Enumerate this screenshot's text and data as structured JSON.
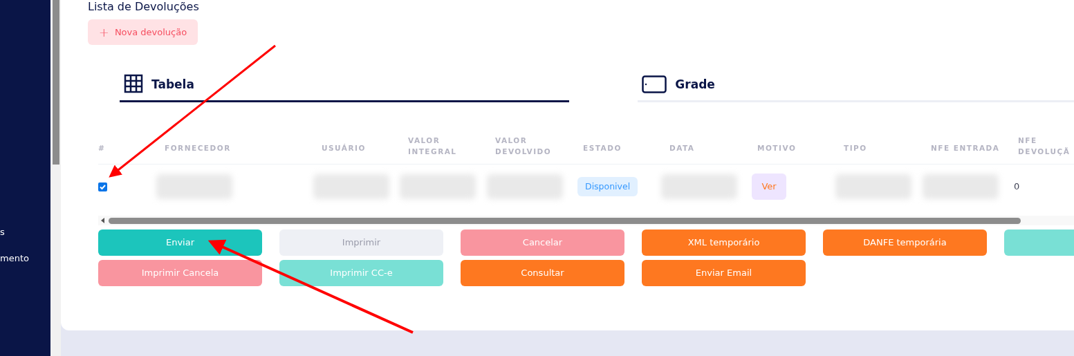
{
  "sidebar": {
    "items": [
      {
        "label": "s"
      },
      {
        "label": "mento"
      }
    ]
  },
  "page": {
    "title": "Lista de Devoluções",
    "new_button": {
      "icon": "+",
      "label": "Nova devolução"
    }
  },
  "tabs": [
    {
      "label": "Tabela",
      "selected": true
    },
    {
      "label": "Grade",
      "selected": false
    }
  ],
  "table": {
    "columns": [
      "#",
      "FORNECEDOR",
      "USUÁRIO",
      "VALOR INTEGRAL",
      "VALOR DEVOLVIDO",
      "ESTADO",
      "DATA",
      "MOTIVO",
      "TIPO",
      "NFE ENTRADA",
      "NFE DEVOLUÇÃ"
    ],
    "rows": [
      {
        "checked": true,
        "cells": [
          {
            "kind": "checkbox"
          },
          {
            "kind": "redacted"
          },
          {
            "kind": "redacted"
          },
          {
            "kind": "redacted"
          },
          {
            "kind": "redacted"
          },
          {
            "kind": "badge",
            "text": "Disponivel"
          },
          {
            "kind": "redacted"
          },
          {
            "kind": "link",
            "text": "Ver"
          },
          {
            "kind": "redacted"
          },
          {
            "kind": "redacted"
          },
          {
            "kind": "text",
            "text": "0"
          }
        ]
      }
    ]
  },
  "actions": [
    {
      "label": "Enviar",
      "color": "#1cc5bc",
      "kind": "solid"
    },
    {
      "label": "Imprimir",
      "color": "#eef0f5",
      "kind": "light"
    },
    {
      "label": "Cancelar",
      "color": "#f9959f",
      "kind": "solid"
    },
    {
      "label": "XML temporário",
      "color": "#fe7820",
      "kind": "solid"
    },
    {
      "label": "DANFE temporária",
      "color": "#fe7820",
      "kind": "solid"
    },
    {
      "color": "#79e0d5",
      "kind": "solid"
    },
    {
      "label": "Imprimir Cancela",
      "color": "#f9959f",
      "kind": "solid"
    },
    {
      "label": "Imprimir CC-e",
      "color": "#79e0d5",
      "kind": "solid"
    },
    {
      "label": "Consultar",
      "color": "#fe7820",
      "kind": "solid"
    },
    {
      "label": "Enviar Email",
      "color": "#fe7820",
      "kind": "solid"
    }
  ]
}
